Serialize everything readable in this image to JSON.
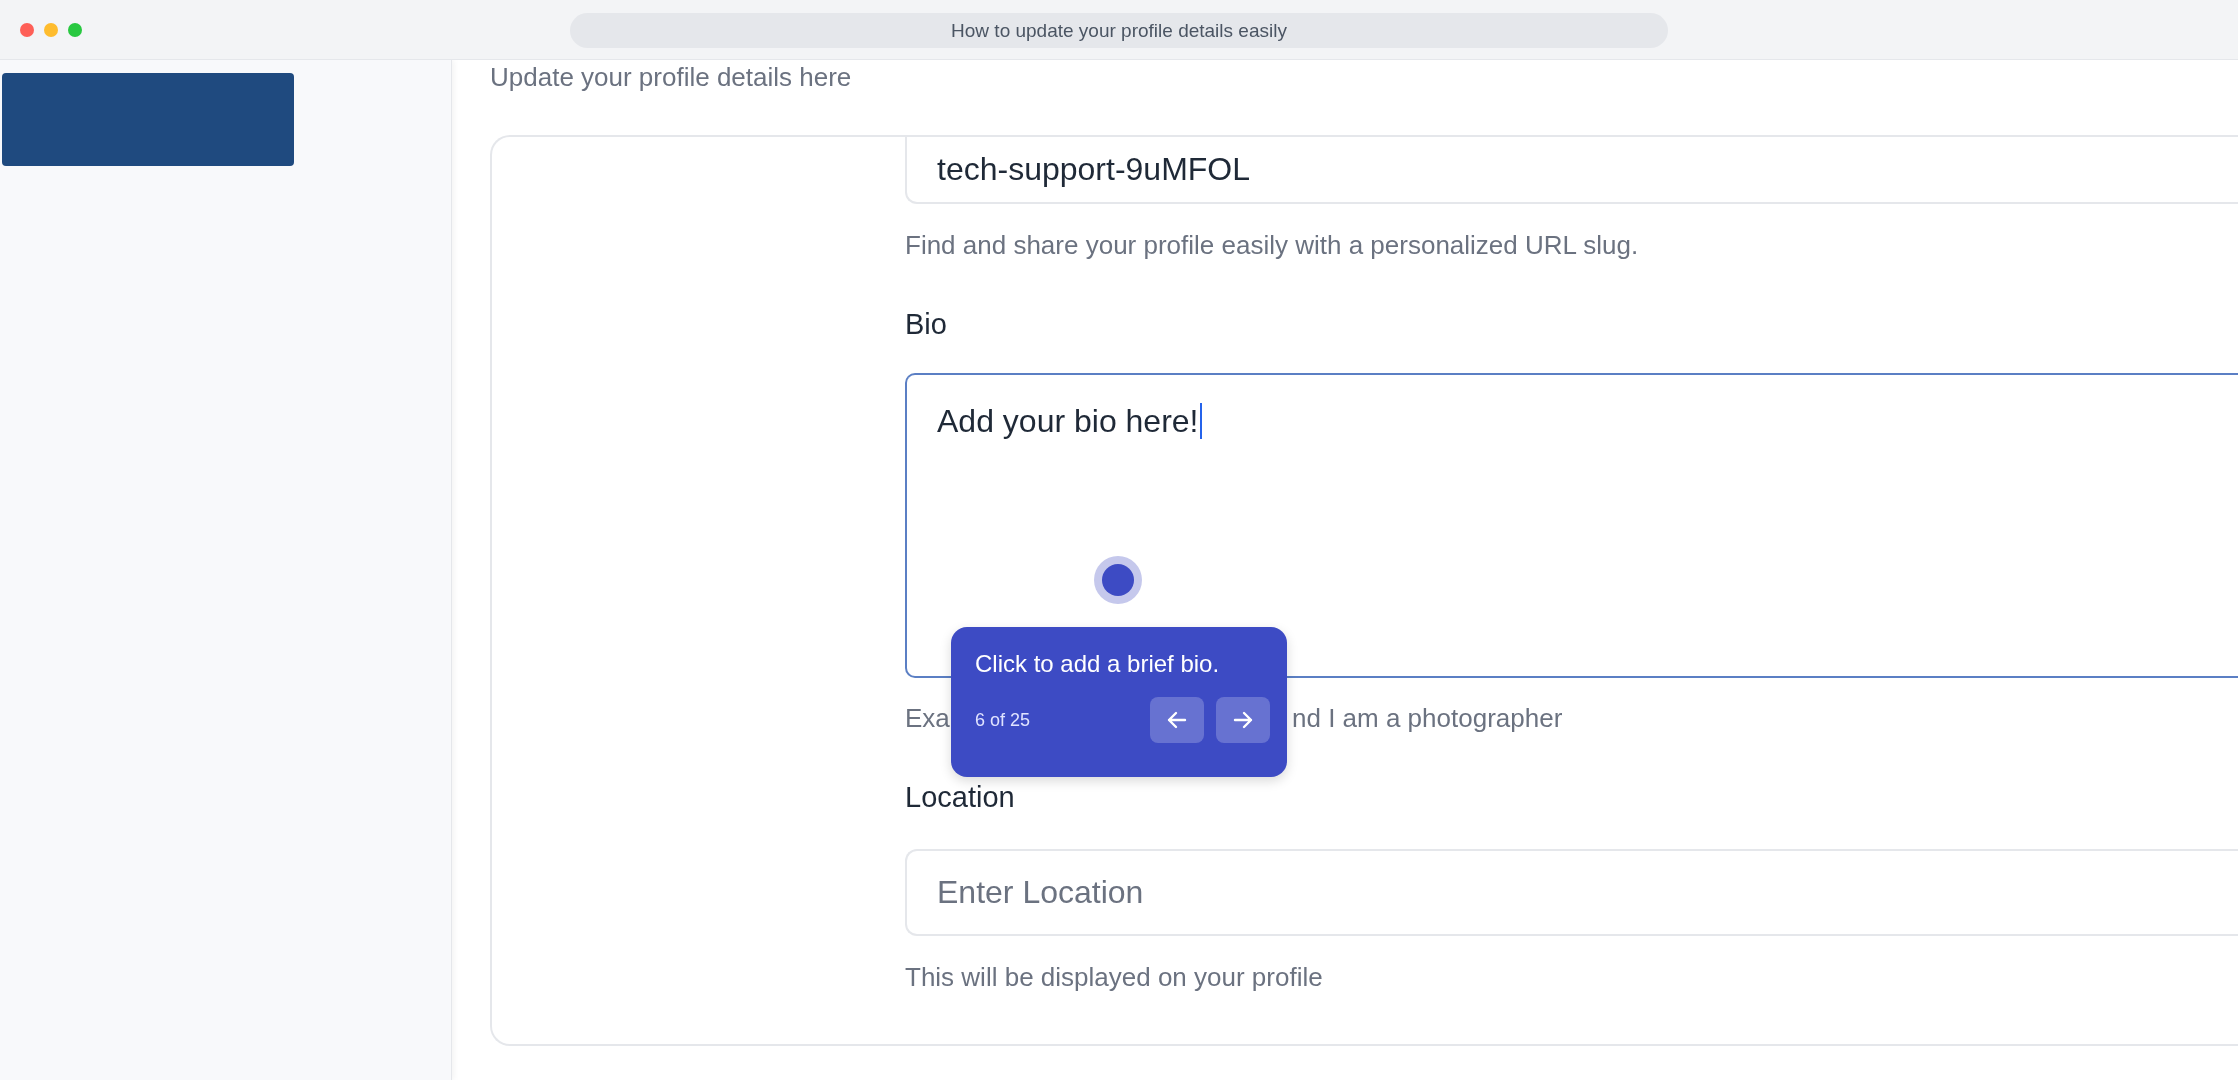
{
  "window": {
    "title": "How to update your profile details easily"
  },
  "page": {
    "subtitle": "Update your profile details here"
  },
  "form": {
    "slug": {
      "value": "tech-support-9uMFOL",
      "helper": "Find and share your profile easily with a personalized URL slug."
    },
    "bio": {
      "label": "Bio",
      "value": "Add your bio here!",
      "focused": true,
      "helper_parts": [
        "Exa",
        "nd I am a photographer"
      ]
    },
    "location": {
      "label": "Location",
      "placeholder": "Enter Location",
      "helper": "This will be displayed on your profile"
    }
  },
  "tooltip": {
    "text": "Click to add a brief bio.",
    "step": "6 of 25"
  }
}
